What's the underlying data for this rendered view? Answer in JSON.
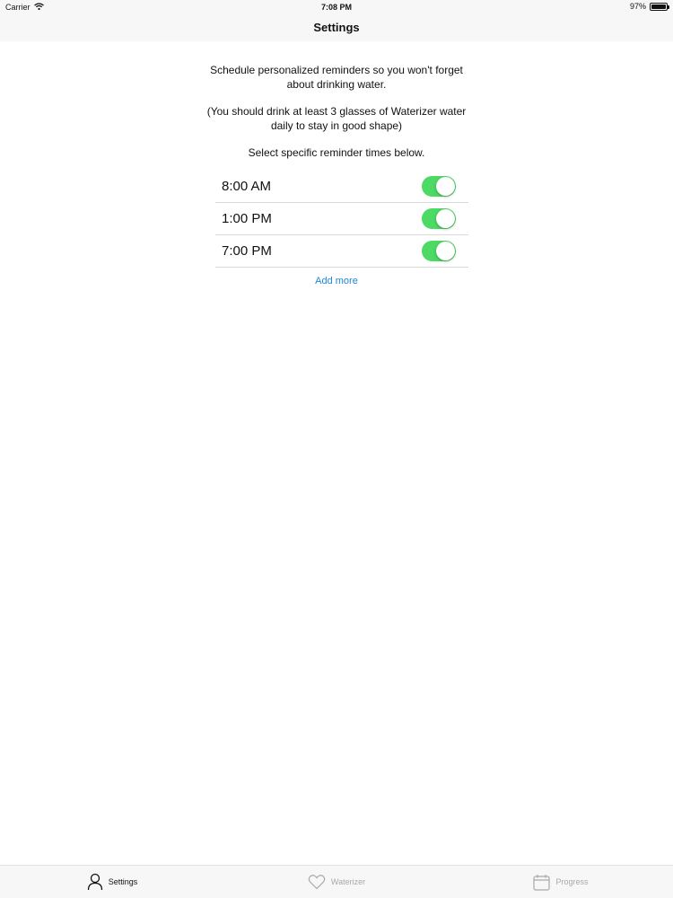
{
  "status_bar": {
    "carrier": "Carrier",
    "time": "7:08 PM",
    "battery": "97%",
    "battery_level": 0.97,
    "icons": [
      "wifi-icon",
      "battery-icon"
    ]
  },
  "nav": {
    "title": "Settings"
  },
  "intro": {
    "line1": "Schedule personalized reminders so you won't forget about drinking water.",
    "line2": "(You should drink at least 3 glasses of Waterizer water daily to stay in good shape)",
    "line3": "Select specific reminder times below."
  },
  "reminders": [
    {
      "time": "8:00 AM",
      "enabled": true
    },
    {
      "time": "1:00 PM",
      "enabled": true
    },
    {
      "time": "7:00 PM",
      "enabled": true
    }
  ],
  "add_more_label": "Add more",
  "colors": {
    "toggle_on": "#4cd964",
    "link": "#1e88d8",
    "bar_background": "#f7f7f7"
  },
  "tabs": [
    {
      "label": "Settings",
      "icon": "person-icon",
      "active": true
    },
    {
      "label": "Waterizer",
      "icon": "heart-icon",
      "active": false
    },
    {
      "label": "Progress",
      "icon": "calendar-icon",
      "active": false
    }
  ]
}
